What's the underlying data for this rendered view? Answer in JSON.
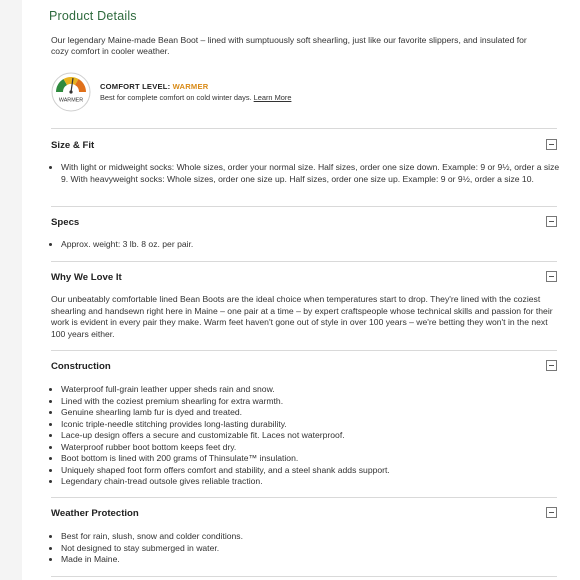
{
  "product_details": {
    "title": "Product Details",
    "intro": "Our legendary Maine-made Bean Boot – lined with sumptuously soft shearling, just like our favorite slippers, and insulated for cozy comfort in cooler weather.",
    "comfort": {
      "gauge_label": "WARMER",
      "label": "COMFORT LEVEL:",
      "value": "WARMER",
      "description": "Best for complete comfort on cold winter days.",
      "link": "Learn More",
      "colors": {
        "green": "#2f8a3e",
        "yellow": "#e8b21e",
        "orange": "#e0701a",
        "text": "#d98a16"
      }
    }
  },
  "sections": {
    "size_fit": {
      "title": "Size & Fit",
      "items": [
        "With light or midweight socks: Whole sizes, order your normal size. Half sizes, order one size down. Example: 9 or 9½, order a size 9. With heavyweight socks: Whole sizes, order one size up. Half sizes, order one size up. Example: 9 or 9½, order a size 10."
      ]
    },
    "specs": {
      "title": "Specs",
      "items": [
        "Approx. weight: 3 lb. 8 oz. per pair."
      ]
    },
    "why_we_love_it": {
      "title": "Why We Love It",
      "text": "Our unbeatably comfortable lined Bean Boots are the ideal choice when temperatures start to drop. They're lined with the coziest shearling and handsewn right here in Maine – one pair at a time – by expert craftspeople whose technical skills and passion for their work is evident in every pair they make. Warm feet haven't gone out of style in over 100 years – we're betting they won't in the next 100 years either."
    },
    "construction": {
      "title": "Construction",
      "items": [
        "Waterproof full-grain leather upper sheds rain and snow.",
        "Lined with the coziest premium shearling for extra warmth.",
        "Genuine shearling lamb fur is dyed and treated.",
        "Iconic triple-needle stitching provides long-lasting durability.",
        "Lace-up design offers a secure and customizable fit. Laces not waterproof.",
        "Waterproof rubber boot bottom keeps feet dry.",
        "Boot bottom is lined with 200 grams of Thinsulate™ insulation.",
        "Uniquely shaped foot form offers comfort and stability, and a steel shank adds support.",
        "Legendary chain-tread outsole gives reliable traction."
      ]
    },
    "weather": {
      "title": "Weather Protection",
      "items": [
        "Best for rain, slush, snow and colder conditions.",
        "Not designed to stay submerged in water.",
        "Made in Maine."
      ]
    }
  },
  "colors": {
    "title_green": "#2f6b3e",
    "divider": "#d9d9d9",
    "rail": "#f4f4f4"
  }
}
